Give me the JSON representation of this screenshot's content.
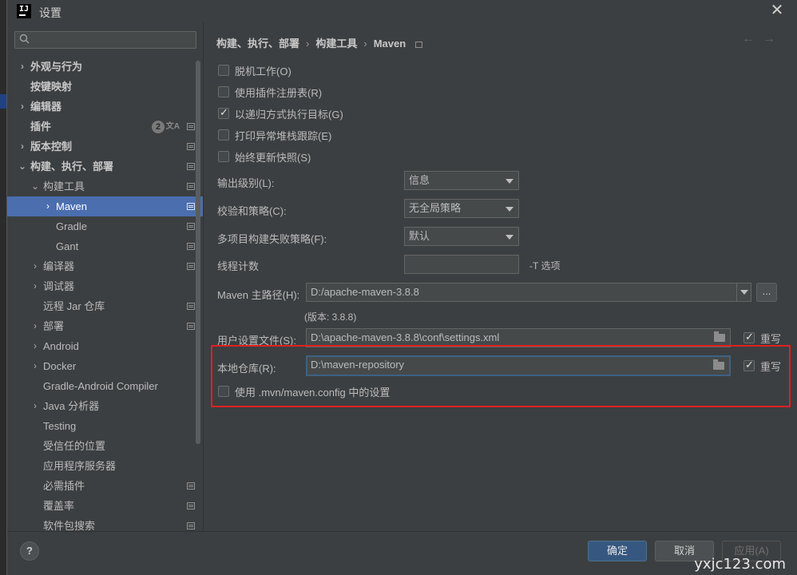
{
  "window": {
    "title": "设置",
    "app_icon": "IJ"
  },
  "sidebar": {
    "search_placeholder": "",
    "items": [
      {
        "label": "外观与行为",
        "arrow": "›",
        "bold": true
      },
      {
        "label": "按键映射",
        "arrow": "",
        "bold": true
      },
      {
        "label": "编辑器",
        "arrow": "›",
        "bold": true
      },
      {
        "label": "插件",
        "arrow": "",
        "bold": true,
        "badge": "2"
      },
      {
        "label": "版本控制",
        "arrow": "›",
        "bold": true
      },
      {
        "label": "构建、执行、部署",
        "arrow": "⌄",
        "bold": true
      },
      {
        "label": "构建工具",
        "arrow": "⌄"
      },
      {
        "label": "Maven",
        "arrow": "›",
        "selected": true
      },
      {
        "label": "Gradle",
        "arrow": ""
      },
      {
        "label": "Gant",
        "arrow": ""
      },
      {
        "label": "编译器",
        "arrow": "›"
      },
      {
        "label": "调试器",
        "arrow": "›"
      },
      {
        "label": "远程 Jar 仓库",
        "arrow": ""
      },
      {
        "label": "部署",
        "arrow": "›"
      },
      {
        "label": "Android",
        "arrow": "›"
      },
      {
        "label": "Docker",
        "arrow": "›"
      },
      {
        "label": "Gradle-Android Compiler",
        "arrow": ""
      },
      {
        "label": "Java 分析器",
        "arrow": "›"
      },
      {
        "label": "Testing",
        "arrow": ""
      },
      {
        "label": "受信任的位置",
        "arrow": ""
      },
      {
        "label": "应用程序服务器",
        "arrow": ""
      },
      {
        "label": "必需插件",
        "arrow": ""
      },
      {
        "label": "覆盖率",
        "arrow": ""
      },
      {
        "label": "软件包搜索",
        "arrow": ""
      }
    ]
  },
  "breadcrumb": {
    "part1": "构建、执行、部署",
    "sep": "›",
    "part2": "构建工具",
    "part3": "Maven"
  },
  "nav": {
    "back": "←",
    "forward": "→"
  },
  "checkboxes": {
    "offline": {
      "label": "脱机工作(O)",
      "checked": false
    },
    "plugin_registry": {
      "label": "使用插件注册表(R)",
      "checked": false
    },
    "recursive": {
      "label": "以递归方式执行目标(G)",
      "checked": true
    },
    "stacktrace": {
      "label": "打印异常堆栈跟踪(E)",
      "checked": false
    },
    "update_snapshots": {
      "label": "始终更新快照(S)",
      "checked": false
    }
  },
  "fields": {
    "output_level": {
      "label": "输出级别(L):",
      "value": "信息"
    },
    "checksum": {
      "label": "校验和策略(C):",
      "value": "无全局策略"
    },
    "multiproject": {
      "label": "多项目构建失败策略(F):",
      "value": "默认"
    },
    "threads": {
      "label": "线程计数",
      "value": "",
      "hint": "-T 选项"
    },
    "maven_home": {
      "label": "Maven 主路径(H):",
      "value": "D:/apache-maven-3.8.8",
      "version": "(版本: 3.8.8)",
      "browse": "..."
    },
    "user_settings": {
      "label": "用户设置文件(S):",
      "value": "D:\\apache-maven-3.8.8\\conf\\settings.xml",
      "override_label": "重写",
      "override": true
    },
    "local_repo": {
      "label": "本地仓库(R):",
      "value": "D:\\maven-repository",
      "override_label": "重写",
      "override": true
    },
    "mvn_config": {
      "label": "使用 .mvn/maven.config 中的设置",
      "checked": false
    }
  },
  "footer": {
    "help": "?",
    "ok": "确定",
    "cancel": "取消",
    "apply": "应用(A)"
  },
  "watermark": "yxjc123.com",
  "colors": {
    "accent": "#365880",
    "selection": "#4b6eaf",
    "highlight_box": "#e02020"
  }
}
